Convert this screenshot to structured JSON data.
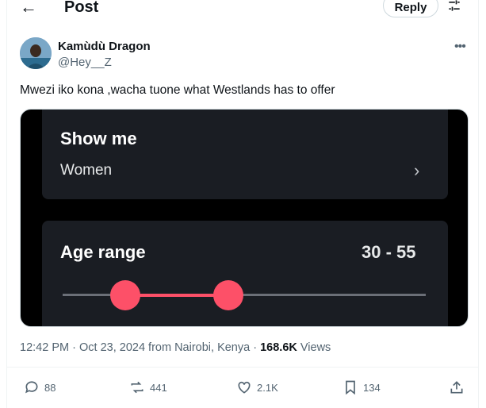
{
  "header": {
    "title": "Post",
    "reply_label": "Reply",
    "back_icon": "←"
  },
  "author": {
    "name": "Kamùdù Dragon",
    "handle": "@Hey__Z"
  },
  "more_icon": "•••",
  "tweet": {
    "text": "Mwezi iko kona ,wacha tuone what Westlands has to offer"
  },
  "media": {
    "show_me_label": "Show me",
    "show_me_value": "Women",
    "chevron": "›",
    "age_range_label": "Age range",
    "age_range_value": "30 - 55",
    "accent_color": "#fd5068"
  },
  "meta": {
    "time": "12:42 PM",
    "date": "Oct 23, 2024",
    "location": "from Nairobi, Kenya",
    "views_count": "168.6K",
    "views_label": "Views",
    "separator": "·"
  },
  "actions": {
    "replies": "88",
    "reposts": "441",
    "likes": "2.1K",
    "bookmarks": "134"
  }
}
